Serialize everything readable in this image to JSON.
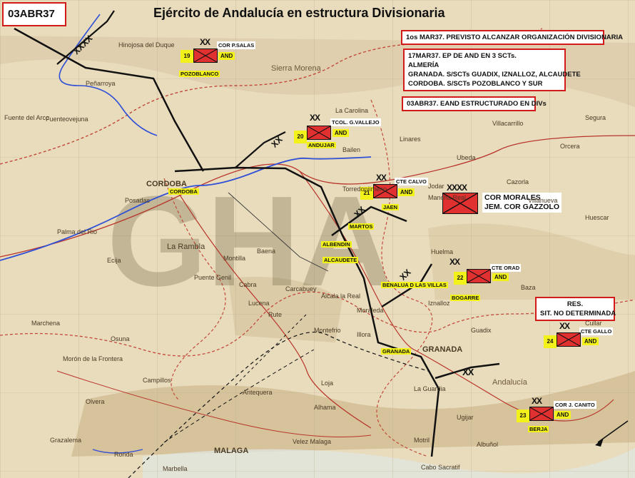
{
  "header": {
    "title": "Ejército de Andalucía en estructura Divisionaria"
  },
  "date_box": "03ABR37",
  "notes": {
    "note1": "1os MAR37. PREVISTO ALCANZAR ORGANIZACIÓN DIVISIONARIA",
    "note2_lines": [
      "17MAR37. EP DE AND EN 3 SCTs.",
      "ALMERÍA",
      "GRANADA. S/SCTs GUADIX, IZNALLOZ, ALCAUDETE",
      "CORDOBA. S/SCTs POZOBLANCO Y SUR"
    ],
    "note3": "03ABR37. EAND ESTRUCTURADO EN DIVs",
    "reserve_lines": [
      "RES.",
      "SIT. NO DETERMINADA"
    ]
  },
  "hq": {
    "echelon": "XXXX",
    "lines": [
      "COR MORALES",
      "JEM. COR GAZZOLO"
    ]
  },
  "units": [
    {
      "num": "19",
      "tag": "AND",
      "commander": "COR P.SALAS",
      "city": "POZOBLANCO",
      "echelon": "XX"
    },
    {
      "num": "20",
      "tag": "AND",
      "commander": "TCOL. G.VALLEJO",
      "city": "ANDUJAR",
      "echelon": "XX"
    },
    {
      "num": "21",
      "tag": "AND",
      "commander": "CTE CALVO",
      "city": "JAEN",
      "echelon": "XX"
    },
    {
      "num": "22",
      "tag": "AND",
      "commander": "CTE ORAD",
      "city": "BOGARRE",
      "echelon": "XX"
    },
    {
      "num": "24",
      "tag": "AND",
      "commander": "CTE GALLO",
      "city": "",
      "echelon": "XX"
    },
    {
      "num": "23",
      "tag": "AND",
      "commander": "COR J. CANITO",
      "city": "BERJA",
      "echelon": "XX"
    }
  ],
  "cities": {
    "cordoba": "CORDOBA",
    "martos": "MARTOS",
    "alcaudete": "ALCAUDETE",
    "albendin": "ALBENDIN",
    "benalua": "BENALUA D LAS VILLAS",
    "granada": "GRANADA"
  },
  "boundaries": {
    "xx1": "XX",
    "xx2": "XX",
    "xx3": "XX",
    "xx4": "XX",
    "xxxx": "XXXX"
  },
  "map_text": [
    "CORDOBA",
    "Posadas",
    "Palma del Rio",
    "Ecija",
    "Osuna",
    "Marchena",
    "La Rambla",
    "Montilla",
    "Baena",
    "Lucena",
    "Rute",
    "Antequera",
    "Loja",
    "MALAGA",
    "Motril",
    "GRANADA",
    "Guadix",
    "Baza",
    "Ubeda",
    "Jodar",
    "La Carolina",
    "Bailen",
    "Alcala la Real",
    "Cabra",
    "Olvera",
    "Grazalema",
    "Ronda",
    "Marbella",
    "Albuñol",
    "Ugijar",
    "Carcabuey",
    "Montefrio",
    "Illora",
    "Moraleda",
    "Campillos",
    "Morón de la Frontera",
    "Puente Genil",
    "Villacarrillo",
    "Fuenteovejuna",
    "Hinojosa del Duque",
    "Peñarroya",
    "Fuente del Arco",
    "Andalucía",
    "Sierra Morena",
    "Cabo Sacratif",
    "Velez Malaga",
    "Alhama",
    "Huelma",
    "Iznalloz",
    "Cazorla",
    "Orcera",
    "Segura",
    "Cullar",
    "Huescar",
    "La Guardia",
    "Mancha Real",
    "Torredonjimeno",
    "Linares",
    "Villanueva"
  ]
}
